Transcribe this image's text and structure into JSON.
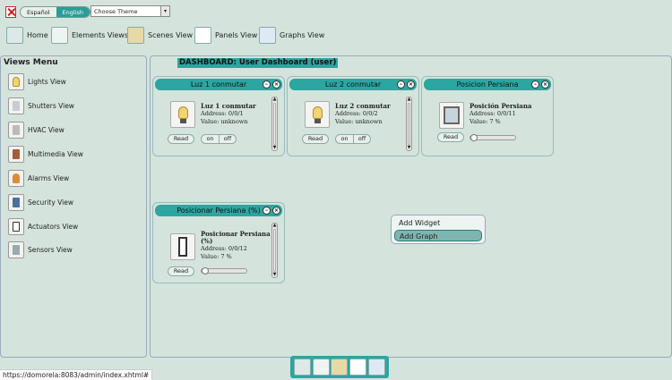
{
  "top": {
    "languages": [
      "Español",
      "English"
    ],
    "theme_placeholder": "Choose Theme"
  },
  "nav": [
    {
      "label": "Home",
      "icon": "home-icon"
    },
    {
      "label": "Elements Views",
      "icon": "elements-icon"
    },
    {
      "label": "Scenes View",
      "icon": "scenes-icon"
    },
    {
      "label": "Panels View",
      "icon": "panels-icon"
    },
    {
      "label": "Graphs View",
      "icon": "graphs-icon"
    }
  ],
  "views_menu": {
    "title": "Views Menu",
    "items": [
      {
        "label": "Lights View",
        "icon": "bulb-icon"
      },
      {
        "label": "Shutters View",
        "icon": "shutter-icon"
      },
      {
        "label": "HVAC View",
        "icon": "hvac-icon"
      },
      {
        "label": "Multimedia View",
        "icon": "multimedia-icon"
      },
      {
        "label": "Alarms View",
        "icon": "bell-icon"
      },
      {
        "label": "Security View",
        "icon": "security-icon"
      },
      {
        "label": "Actuators View",
        "icon": "actuator-icon"
      },
      {
        "label": "Sensors View",
        "icon": "sensor-icon"
      }
    ]
  },
  "dashboard": {
    "title": "DASHBOARD: User Dashboard (user)",
    "widgets": [
      {
        "header": "Luz 1 conmutar",
        "name": "Luz 1 conmutar",
        "address": "Address: 0/0/1",
        "value": "Value: unknown",
        "read": "Read",
        "on": "on",
        "off": "off"
      },
      {
        "header": "Luz 2 conmutar",
        "name": "Luz 2 conmutar",
        "address": "Address: 0/0/2",
        "value": "Value: unknown",
        "read": "Read",
        "on": "on",
        "off": "off"
      },
      {
        "header": "Posicion Persiana",
        "name": "Posición Persiana",
        "address": "Address: 0/0/11",
        "value": "Value: 7 %",
        "read": "Read",
        "slider_percent": 7
      },
      {
        "header": "Posicionar Persiana (%)",
        "name": "Posicionar Persiana (%)",
        "address": "Address: 0/0/12",
        "value": "Value: 7 %",
        "read": "Read",
        "slider_percent": 7
      }
    ]
  },
  "context_menu": [
    "Add Widget",
    "Add Graph"
  ],
  "status_url": "https://domorela:8083/admin/index.xhtml#"
}
